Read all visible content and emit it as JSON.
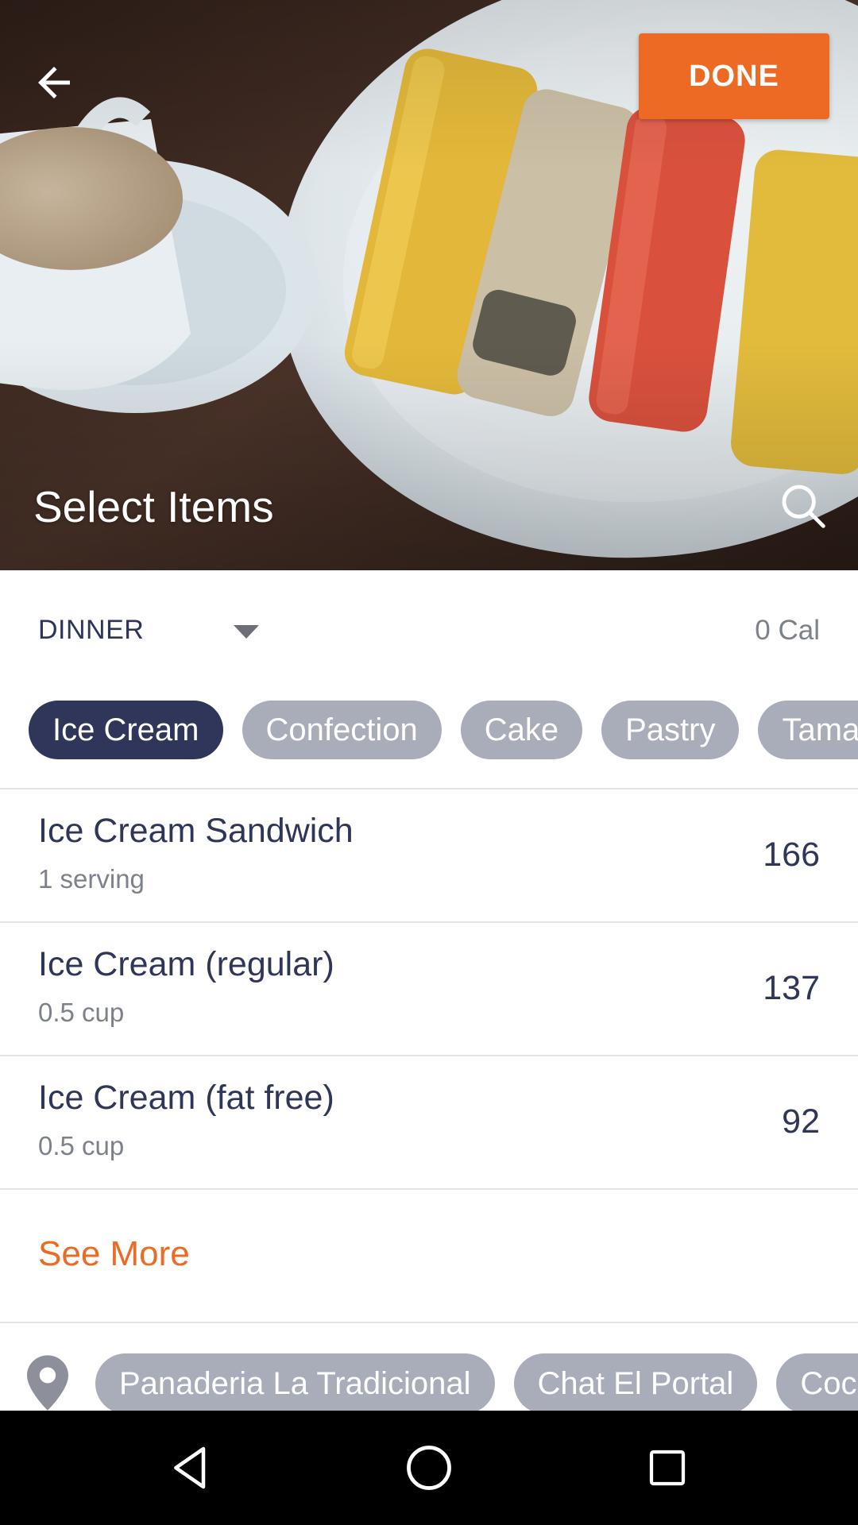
{
  "header": {
    "title": "Select Items",
    "done_label": "DONE",
    "back_icon": "arrow-left-icon",
    "search_icon": "search-icon"
  },
  "meal": {
    "selected": "DINNER",
    "calories": "0 Cal"
  },
  "categories": [
    {
      "label": "Ice Cream",
      "active": true
    },
    {
      "label": "Confection",
      "active": false
    },
    {
      "label": "Cake",
      "active": false
    },
    {
      "label": "Pastry",
      "active": false
    },
    {
      "label": "Tamale",
      "active": false
    }
  ],
  "foods": [
    {
      "name": "Ice Cream Sandwich",
      "serving": "1 serving",
      "calories": "166"
    },
    {
      "name": "Ice Cream (regular)",
      "serving": "0.5 cup",
      "calories": "137"
    },
    {
      "name": "Ice Cream (fat free)",
      "serving": "0.5 cup",
      "calories": "92"
    }
  ],
  "see_more_label": "See More",
  "locations": [
    {
      "label": "Panaderia La Tradicional"
    },
    {
      "label": "Chat El Portal"
    },
    {
      "label": "Cocina"
    }
  ],
  "colors": {
    "accent": "#ec6a23",
    "primary_dark": "#2f3659",
    "chip_inactive": "#a9acb9"
  }
}
